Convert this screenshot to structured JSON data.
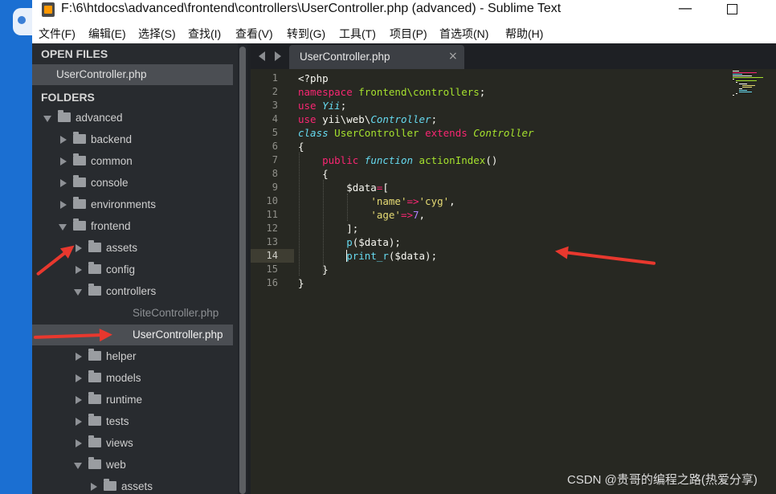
{
  "window": {
    "title": "F:\\6\\htdocs\\advanced\\frontend\\controllers\\UserController.php (advanced) - Sublime Text",
    "minimize_glyph": "—"
  },
  "menu": [
    "文件(F)",
    "编辑(E)",
    "选择(S)",
    "查找(I)",
    "查看(V)",
    "转到(G)",
    "工具(T)",
    "项目(P)",
    "首选项(N)",
    "帮助(H)"
  ],
  "sidebar": {
    "open_files_heading": "OPEN FILES",
    "open_files": [
      "UserController.php"
    ],
    "folders_heading": "FOLDERS",
    "tree": [
      {
        "label": "advanced",
        "type": "folder",
        "open": true,
        "depth": 0
      },
      {
        "label": "backend",
        "type": "folder",
        "open": false,
        "depth": 1
      },
      {
        "label": "common",
        "type": "folder",
        "open": false,
        "depth": 1
      },
      {
        "label": "console",
        "type": "folder",
        "open": false,
        "depth": 1
      },
      {
        "label": "environments",
        "type": "folder",
        "open": false,
        "depth": 1
      },
      {
        "label": "frontend",
        "type": "folder",
        "open": true,
        "depth": 1
      },
      {
        "label": "assets",
        "type": "folder",
        "open": false,
        "depth": 2
      },
      {
        "label": "config",
        "type": "folder",
        "open": false,
        "depth": 2
      },
      {
        "label": "controllers",
        "type": "folder",
        "open": true,
        "depth": 2
      },
      {
        "label": "SiteController.php",
        "type": "file",
        "depth": 3
      },
      {
        "label": "UserController.php",
        "type": "file",
        "depth": 3,
        "selected": true
      },
      {
        "label": "helper",
        "type": "folder",
        "open": false,
        "depth": 2
      },
      {
        "label": "models",
        "type": "folder",
        "open": false,
        "depth": 2
      },
      {
        "label": "runtime",
        "type": "folder",
        "open": false,
        "depth": 2
      },
      {
        "label": "tests",
        "type": "folder",
        "open": false,
        "depth": 2
      },
      {
        "label": "views",
        "type": "folder",
        "open": false,
        "depth": 2
      },
      {
        "label": "web",
        "type": "folder",
        "open": true,
        "depth": 2
      },
      {
        "label": "assets",
        "type": "folder",
        "open": false,
        "depth": 3
      }
    ]
  },
  "tabs": [
    {
      "label": "UserController.php",
      "close": "×",
      "active": true
    }
  ],
  "editor": {
    "current_line": 14,
    "lines": [
      {
        "n": "1",
        "html": "&lt;?php"
      },
      {
        "n": "2",
        "html": "<span class=\"kw\">namespace</span> <span class=\"cl\">frontend\\controllers</span>;"
      },
      {
        "n": "3",
        "html": "<span class=\"kw\">use</span> <span class=\"st\">Yii</span>;"
      },
      {
        "n": "4",
        "html": "<span class=\"kw\">use</span> yii\\web\\<span class=\"st\">Controller</span>;"
      },
      {
        "n": "5",
        "html": "<span class=\"st\">class</span> <span class=\"cl\">UserController</span> <span class=\"kw\">extends</span> <span class=\"st\" style=\"color:#a6e22e\">Controller</span>"
      },
      {
        "n": "6",
        "html": "{"
      },
      {
        "n": "7",
        "html": "    <span class=\"kw\">public</span> <span class=\"st\">function</span> <span class=\"cl\">actionIndex</span>()"
      },
      {
        "n": "8",
        "html": "    {"
      },
      {
        "n": "9",
        "html": "        $data<span class=\"kw\">=</span>["
      },
      {
        "n": "10",
        "html": "            <span class=\"str\">'name'</span><span class=\"kw\">=&gt;</span><span class=\"str\">'cyg'</span>,"
      },
      {
        "n": "11",
        "html": "            <span class=\"str\">'age'</span><span class=\"kw\">=&gt;</span><span class=\"num\">7</span>,"
      },
      {
        "n": "12",
        "html": "        ];"
      },
      {
        "n": "13",
        "html": "        <span class=\"fn\">p</span>($data);"
      },
      {
        "n": "14",
        "html": "        <span class=\"fn\">print_r</span>($data);"
      },
      {
        "n": "15",
        "html": "    }"
      },
      {
        "n": "16",
        "html": "}"
      }
    ]
  },
  "watermark": "CSDN @贵哥的编程之路(热爱分享)"
}
